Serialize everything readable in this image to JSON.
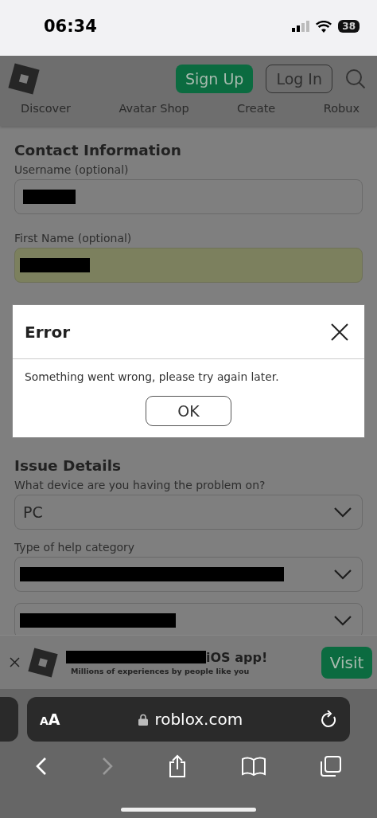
{
  "status_bar": {
    "time": "06:34",
    "battery": "38"
  },
  "header": {
    "buttons": [
      {
        "label": "Sign Up",
        "kind": "primary"
      },
      {
        "label": "Log In",
        "kind": "outline"
      }
    ]
  },
  "nav": [
    {
      "label": "Discover"
    },
    {
      "label": "Avatar Shop"
    },
    {
      "label": "Create"
    },
    {
      "label": "Robux"
    }
  ],
  "contact": {
    "title": "Contact Information",
    "fields": [
      {
        "label": "Username (optional)",
        "autofilled": false,
        "redacted": true
      },
      {
        "label": "First Name (optional)",
        "autofilled": true,
        "redacted": true
      }
    ]
  },
  "dialog": {
    "title": "Error",
    "message": "Something went wrong, please try again later.",
    "button": "OK"
  },
  "issue": {
    "title": "Issue Details",
    "selects": [
      {
        "label": "What device are you having the problem on?",
        "value": "PC",
        "redacted": false
      },
      {
        "label": "Type of help category",
        "redacted": true
      },
      {
        "redacted": true
      }
    ]
  },
  "banner": {
    "title": "iOS app!",
    "subtitle": "Millions of experiences by people like you",
    "button": "Visit"
  },
  "browser": {
    "text_size_button": "AA",
    "address": "roblox.com"
  }
}
